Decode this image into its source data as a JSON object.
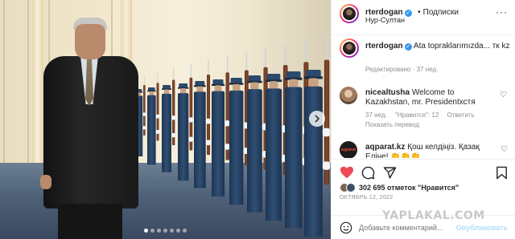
{
  "post": {
    "username": "rterdogan",
    "follow_label": "Подписки",
    "location": "Нур-Султан",
    "caption_user": "rterdogan",
    "caption_text": "Ata topraklarımızda... тк kz",
    "caption_time": "Редактировано · 37 нед."
  },
  "comments": [
    {
      "user": "nicealtusha",
      "text": "Welcome to Kazakhstan, mr. Presidentхстя",
      "time": "37 нед.",
      "likes": "\"Нравится\": 12",
      "reply": "Ответить",
      "translate": "Показать перевод"
    },
    {
      "user": "aqparat.kz",
      "text": "Қош келдіңіз. Қазақ Елінe! 👏👏👏",
      "avatar_label": "aqparat"
    }
  ],
  "likes": {
    "count_text": "302 695 отметок \"Нравится\""
  },
  "date": "ОКТЯБРЬ 12, 2022",
  "comment_input": {
    "placeholder": "Добавьте комментарий...",
    "publish": "Опубликовать"
  },
  "watermark": "YAPLAKAL.COM",
  "carousel": {
    "total": 7,
    "active": 0
  },
  "colors": {
    "verified": "#3897f0",
    "like_red": "#ed4956",
    "link": "#0095f6"
  }
}
